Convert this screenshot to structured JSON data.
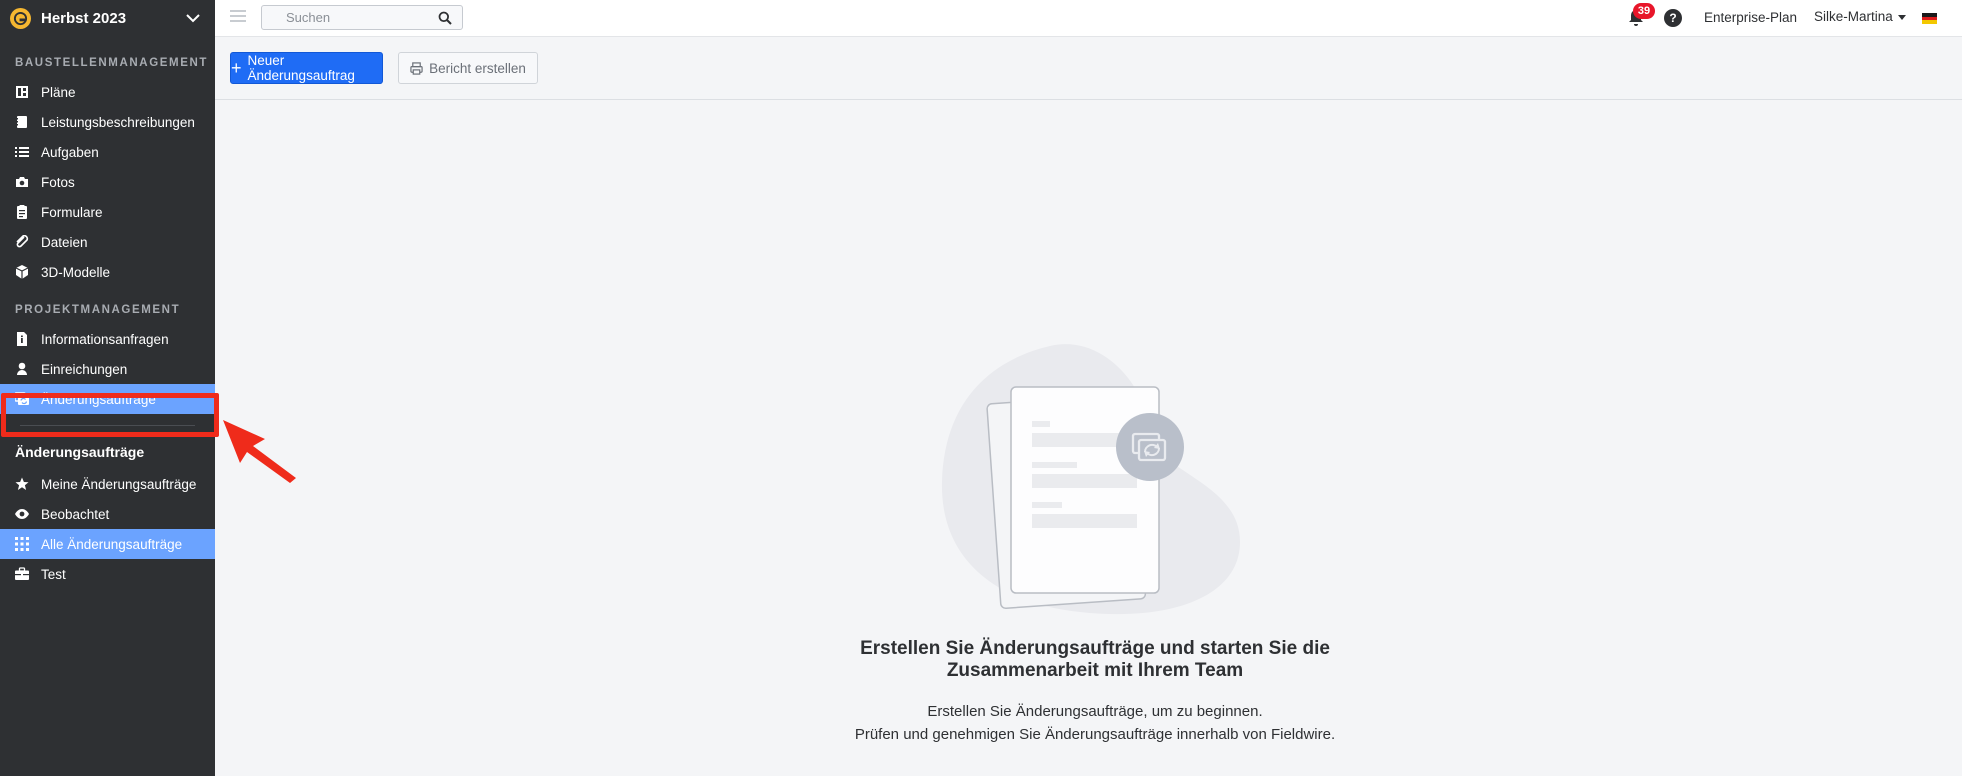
{
  "sidebar": {
    "project_name": "Herbst 2023",
    "section_construction": "BAUSTELLENMANAGEMENT",
    "construction_items": [
      {
        "label": "Pläne",
        "icon": "plans-icon"
      },
      {
        "label": "Leistungsbeschreibungen",
        "icon": "specifications-icon"
      },
      {
        "label": "Aufgaben",
        "icon": "tasks-icon"
      },
      {
        "label": "Fotos",
        "icon": "camera-icon"
      },
      {
        "label": "Formulare",
        "icon": "forms-icon"
      },
      {
        "label": "Dateien",
        "icon": "paperclip-icon"
      },
      {
        "label": "3D-Modelle",
        "icon": "cube-icon"
      }
    ],
    "section_project": "PROJEKTMANAGEMENT",
    "project_items": [
      {
        "label": "Informationsanfragen",
        "icon": "rfi-icon"
      },
      {
        "label": "Einreichungen",
        "icon": "submittals-icon"
      },
      {
        "label": "Änderungsaufträge",
        "icon": "change-orders-icon",
        "active": true
      }
    ],
    "sub_title": "Änderungsaufträge",
    "filter_items": [
      {
        "label": "Meine Änderungsaufträge",
        "icon": "star-icon"
      },
      {
        "label": "Beobachtet",
        "icon": "eye-icon"
      },
      {
        "label": "Alle Änderungsaufträge",
        "icon": "grid-icon",
        "active": true
      },
      {
        "label": "Test",
        "icon": "briefcase-icon"
      }
    ]
  },
  "topbar": {
    "search_placeholder": "Suchen",
    "notification_count": "39",
    "help_label": "?",
    "plan_label": "Enterprise-Plan",
    "user_name": "Silke-Martina"
  },
  "toolbar": {
    "new_button_label": "Neuer Änderungsauftrag",
    "report_button_label": "Bericht erstellen"
  },
  "empty_state": {
    "title_line1": "Erstellen Sie Änderungsaufträge und starten Sie die",
    "title_line2": "Zusammenarbeit mit Ihrem Team",
    "desc_line1": "Erstellen Sie Änderungsaufträge, um zu beginnen.",
    "desc_line2": "Prüfen und genehmigen Sie Änderungsaufträge innerhalb von Fieldwire."
  },
  "colors": {
    "sidebar_bg": "#2e3033",
    "active_item": "#6ba3ff",
    "primary": "#1f6cf5",
    "badge": "#e8162a",
    "annotation": "#ef2b1b"
  }
}
